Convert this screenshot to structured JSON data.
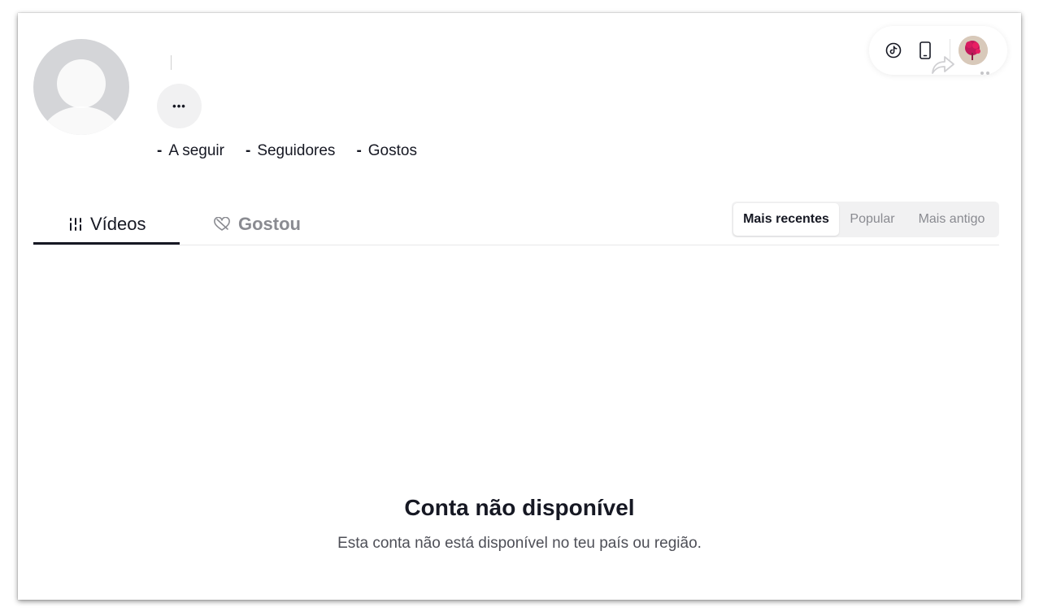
{
  "profile": {
    "more_label": "•••",
    "stats": [
      {
        "value": "-",
        "label": "A seguir"
      },
      {
        "value": "-",
        "label": "Seguidores"
      },
      {
        "value": "-",
        "label": "Gostos"
      }
    ]
  },
  "topbar": {
    "icons": [
      "tiktok-logo-icon",
      "phone-icon",
      "share-icon",
      "user-avatar"
    ]
  },
  "tabs": [
    {
      "label": "Vídeos",
      "icon": "videos-grid-icon",
      "active": true
    },
    {
      "label": "Gostou",
      "icon": "liked-heart-icon",
      "active": false
    }
  ],
  "sort": {
    "options": [
      "Mais recentes",
      "Popular",
      "Mais antigo"
    ],
    "selected": "Mais recentes"
  },
  "empty_state": {
    "title": "Conta não disponível",
    "description": "Esta conta não está disponível no teu país ou região."
  },
  "colors": {
    "text_primary": "#161823",
    "text_muted": "#8a8b91",
    "avatar_placeholder": "#d4d5d8",
    "chip_bg": "#f1f1f2"
  }
}
